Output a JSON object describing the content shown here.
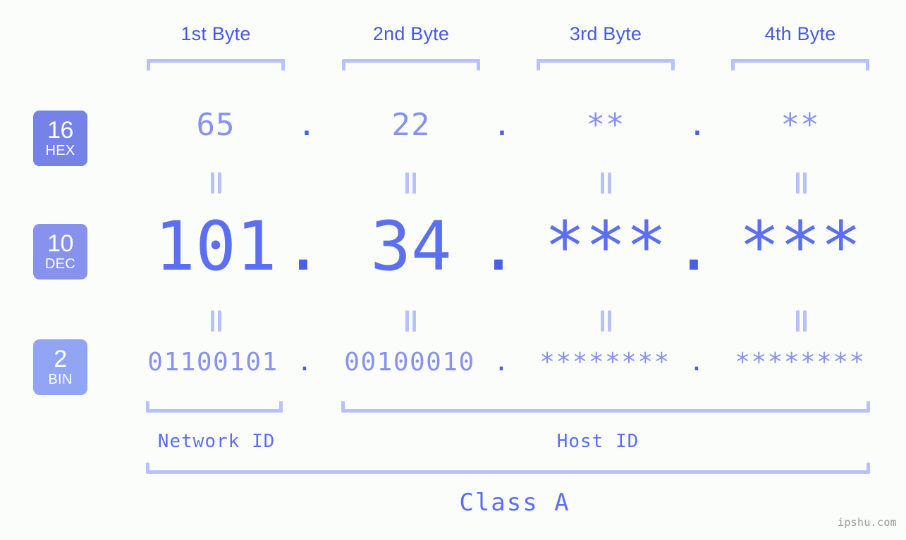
{
  "meta": {
    "watermark": "ipshu.com"
  },
  "columns": [
    {
      "heading": "1st Byte"
    },
    {
      "heading": "2nd Byte"
    },
    {
      "heading": "3rd Byte"
    },
    {
      "heading": "4th Byte"
    }
  ],
  "rows": [
    {
      "base_number": "16",
      "base_name": "HEX",
      "color": "#7582e8",
      "values": [
        "65",
        "22",
        "**",
        "**"
      ],
      "separator": "."
    },
    {
      "base_number": "10",
      "base_name": "DEC",
      "color": "#8792ec",
      "values": [
        "101",
        "34",
        "***",
        "***"
      ],
      "separator": "."
    },
    {
      "base_number": "2",
      "base_name": "BIN",
      "color": "#92a5f5",
      "values": [
        "01100101",
        "00100010",
        "********",
        "********"
      ],
      "separator": "."
    }
  ],
  "equality_marker": "=",
  "segments": {
    "network_id": "Network ID",
    "host_id": "Host ID",
    "class": "Class A"
  },
  "colors": {
    "background": "#fbfdfa",
    "heading": "#4558e6",
    "bracket": "#b9c1fb",
    "value_muted": "#8891ee",
    "value_strong": "#5b6ff0",
    "dot": "#4a5ee8",
    "watermark": "#9a9a9a"
  }
}
